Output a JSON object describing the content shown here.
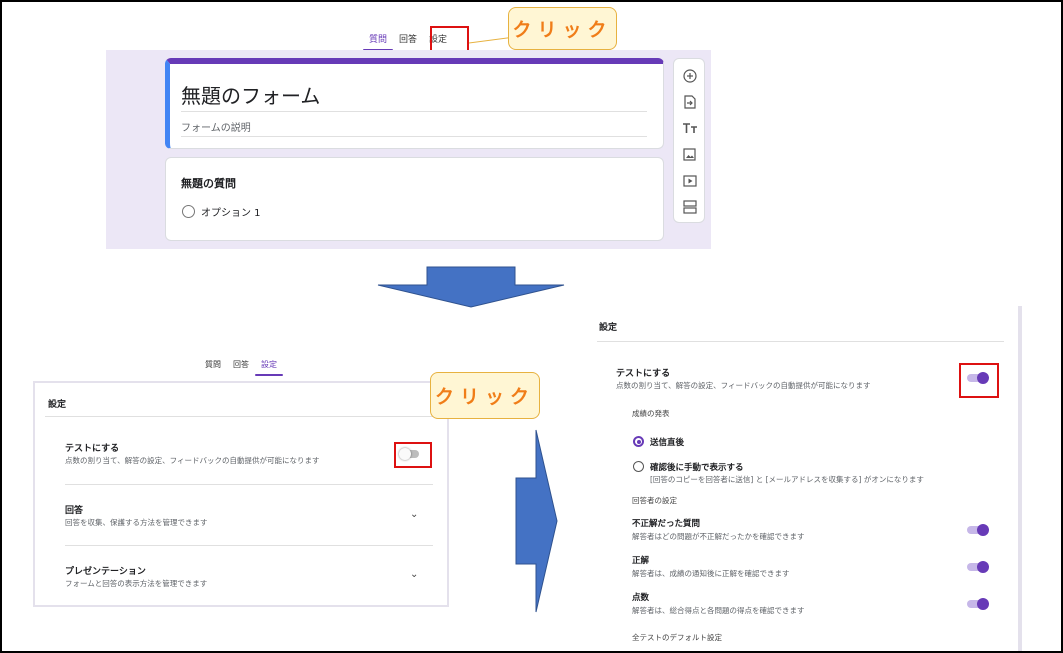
{
  "editor": {
    "tabs": [
      "質問",
      "回答",
      "設定"
    ],
    "form_title": "無題のフォーム",
    "form_description": "フォームの説明",
    "question_title": "無題の質問",
    "option_label": "オプション 1",
    "toolbar_icons": [
      "add-question-icon",
      "import-questions-icon",
      "add-title-icon",
      "add-image-icon",
      "add-video-icon",
      "add-section-icon"
    ]
  },
  "callouts": {
    "click_label": "クリック"
  },
  "settings_collapsed": {
    "tabs": [
      "質問",
      "回答",
      "設定"
    ],
    "title": "設定",
    "quiz_title": "テストにする",
    "quiz_desc": "点数の割り当て、解答の設定、フィードバックの自動提供が可能になります",
    "responses_title": "回答",
    "responses_desc": "回答を収集、保護する方法を管理できます",
    "presentation_title": "プレゼンテーション",
    "presentation_desc": "フォームと回答の表示方法を管理できます"
  },
  "settings_expanded": {
    "title": "設定",
    "quiz_title": "テストにする",
    "quiz_desc": "点数の割り当て、解答の設定、フィードバックの自動提供が可能になります",
    "release_heading": "成績の発表",
    "release_immediate": "送信直後",
    "release_manual": "確認後に手動で表示する",
    "release_manual_desc": "[回答のコピーを回答者に送信] と [メールアドレスを収集する] がオンになります",
    "respondent_heading": "回答者の設定",
    "missed_title": "不正解だった質問",
    "missed_desc": "解答者はどの問題が不正解だったかを確認できます",
    "correct_title": "正解",
    "correct_desc": "解答者は、成績の通知後に正解を確認できます",
    "points_title": "点数",
    "points_desc": "解答者は、総合得点と各問題の得点を確認できます",
    "defaults_heading": "全テストのデフォルト設定"
  },
  "colors": {
    "accent": "#673ab7",
    "callout_text": "#f07d18",
    "callout_bg": "#fff6d4",
    "highlight_box": "#dd1111",
    "arrow_fill": "#4472c4"
  }
}
